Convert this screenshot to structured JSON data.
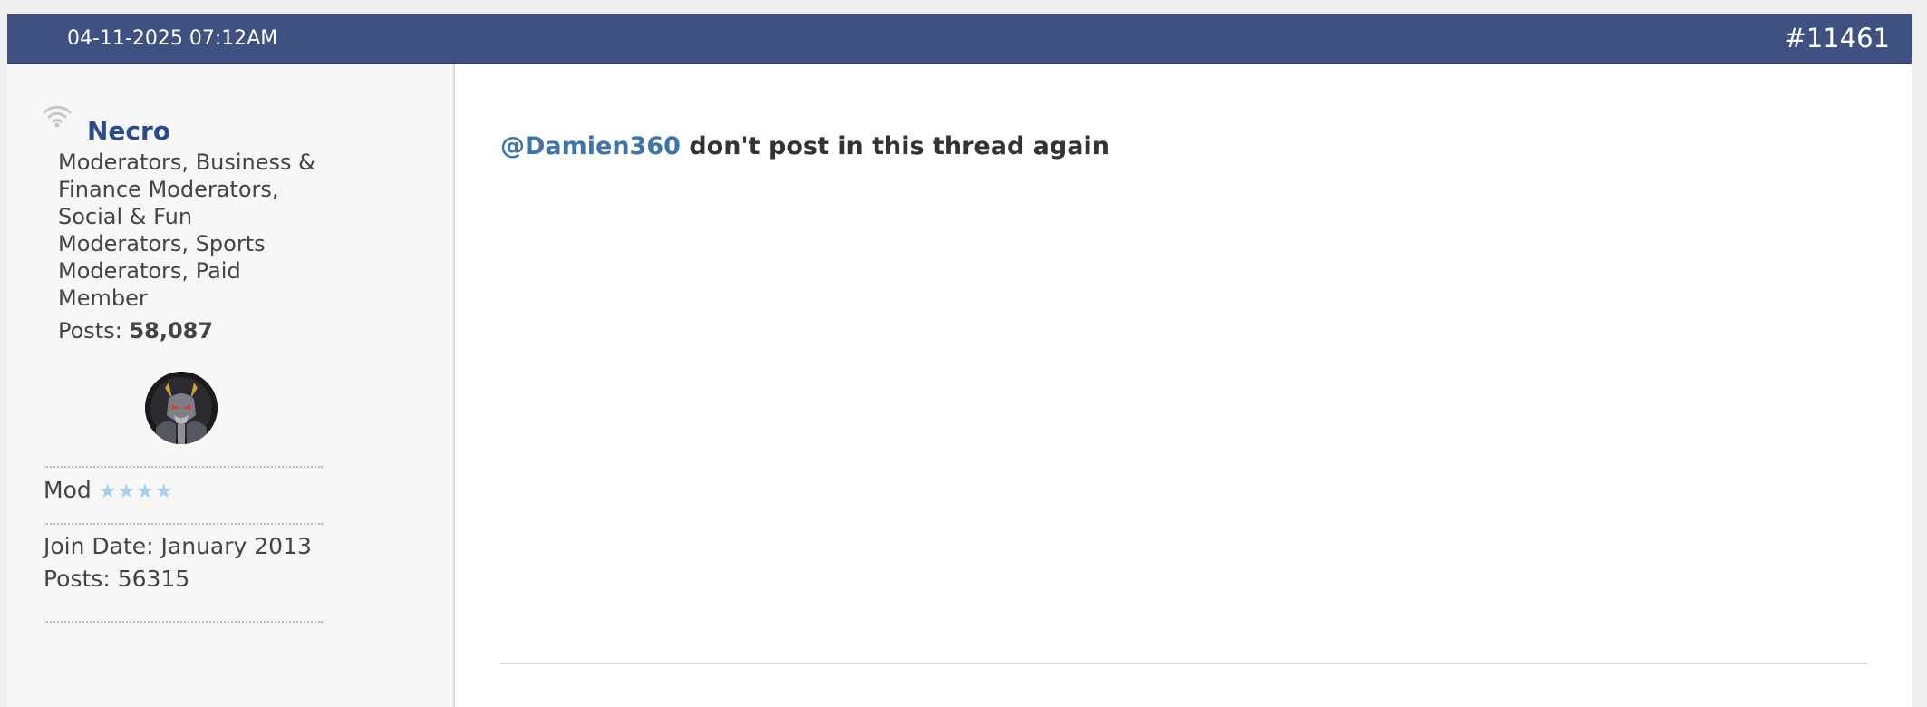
{
  "post": {
    "date": "04-11-2025 07:12AM",
    "number": "#11461"
  },
  "user": {
    "name": "Necro",
    "title": "Moderators, Business & Finance Moderators, Social & Fun Moderators, Sports Moderators, Paid Member",
    "posts_label": "Posts:",
    "posts_value": "58,087",
    "rank": "Mod",
    "rank_stars": "★★★★",
    "join_date": "Join Date: January 2013",
    "posts_total": "Posts: 56315",
    "online_icon": "wifi-signal-icon"
  },
  "message": {
    "mention": "@Damien360",
    "text": " don't post in this thread again"
  },
  "colors": {
    "header_bg": "#3e5180",
    "username": "#2b4a8b",
    "mention": "#3f74a8",
    "stars": "#a8cfe8"
  }
}
